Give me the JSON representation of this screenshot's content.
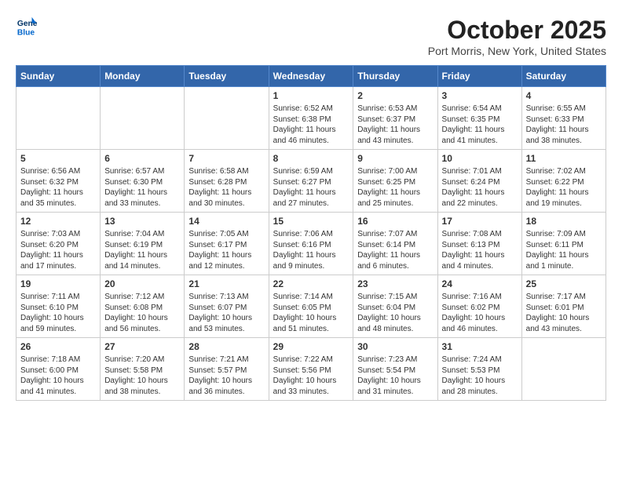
{
  "header": {
    "logo_line1": "General",
    "logo_line2": "Blue",
    "month_title": "October 2025",
    "location": "Port Morris, New York, United States"
  },
  "weekdays": [
    "Sunday",
    "Monday",
    "Tuesday",
    "Wednesday",
    "Thursday",
    "Friday",
    "Saturday"
  ],
  "weeks": [
    [
      {
        "day": "",
        "empty": true
      },
      {
        "day": "",
        "empty": true
      },
      {
        "day": "",
        "empty": true
      },
      {
        "day": "1",
        "sunrise": "6:52 AM",
        "sunset": "6:38 PM",
        "daylight": "11 hours and 46 minutes."
      },
      {
        "day": "2",
        "sunrise": "6:53 AM",
        "sunset": "6:37 PM",
        "daylight": "11 hours and 43 minutes."
      },
      {
        "day": "3",
        "sunrise": "6:54 AM",
        "sunset": "6:35 PM",
        "daylight": "11 hours and 41 minutes."
      },
      {
        "day": "4",
        "sunrise": "6:55 AM",
        "sunset": "6:33 PM",
        "daylight": "11 hours and 38 minutes."
      }
    ],
    [
      {
        "day": "5",
        "sunrise": "6:56 AM",
        "sunset": "6:32 PM",
        "daylight": "11 hours and 35 minutes."
      },
      {
        "day": "6",
        "sunrise": "6:57 AM",
        "sunset": "6:30 PM",
        "daylight": "11 hours and 33 minutes."
      },
      {
        "day": "7",
        "sunrise": "6:58 AM",
        "sunset": "6:28 PM",
        "daylight": "11 hours and 30 minutes."
      },
      {
        "day": "8",
        "sunrise": "6:59 AM",
        "sunset": "6:27 PM",
        "daylight": "11 hours and 27 minutes."
      },
      {
        "day": "9",
        "sunrise": "7:00 AM",
        "sunset": "6:25 PM",
        "daylight": "11 hours and 25 minutes."
      },
      {
        "day": "10",
        "sunrise": "7:01 AM",
        "sunset": "6:24 PM",
        "daylight": "11 hours and 22 minutes."
      },
      {
        "day": "11",
        "sunrise": "7:02 AM",
        "sunset": "6:22 PM",
        "daylight": "11 hours and 19 minutes."
      }
    ],
    [
      {
        "day": "12",
        "sunrise": "7:03 AM",
        "sunset": "6:20 PM",
        "daylight": "11 hours and 17 minutes."
      },
      {
        "day": "13",
        "sunrise": "7:04 AM",
        "sunset": "6:19 PM",
        "daylight": "11 hours and 14 minutes."
      },
      {
        "day": "14",
        "sunrise": "7:05 AM",
        "sunset": "6:17 PM",
        "daylight": "11 hours and 12 minutes."
      },
      {
        "day": "15",
        "sunrise": "7:06 AM",
        "sunset": "6:16 PM",
        "daylight": "11 hours and 9 minutes."
      },
      {
        "day": "16",
        "sunrise": "7:07 AM",
        "sunset": "6:14 PM",
        "daylight": "11 hours and 6 minutes."
      },
      {
        "day": "17",
        "sunrise": "7:08 AM",
        "sunset": "6:13 PM",
        "daylight": "11 hours and 4 minutes."
      },
      {
        "day": "18",
        "sunrise": "7:09 AM",
        "sunset": "6:11 PM",
        "daylight": "11 hours and 1 minute."
      }
    ],
    [
      {
        "day": "19",
        "sunrise": "7:11 AM",
        "sunset": "6:10 PM",
        "daylight": "10 hours and 59 minutes."
      },
      {
        "day": "20",
        "sunrise": "7:12 AM",
        "sunset": "6:08 PM",
        "daylight": "10 hours and 56 minutes."
      },
      {
        "day": "21",
        "sunrise": "7:13 AM",
        "sunset": "6:07 PM",
        "daylight": "10 hours and 53 minutes."
      },
      {
        "day": "22",
        "sunrise": "7:14 AM",
        "sunset": "6:05 PM",
        "daylight": "10 hours and 51 minutes."
      },
      {
        "day": "23",
        "sunrise": "7:15 AM",
        "sunset": "6:04 PM",
        "daylight": "10 hours and 48 minutes."
      },
      {
        "day": "24",
        "sunrise": "7:16 AM",
        "sunset": "6:02 PM",
        "daylight": "10 hours and 46 minutes."
      },
      {
        "day": "25",
        "sunrise": "7:17 AM",
        "sunset": "6:01 PM",
        "daylight": "10 hours and 43 minutes."
      }
    ],
    [
      {
        "day": "26",
        "sunrise": "7:18 AM",
        "sunset": "6:00 PM",
        "daylight": "10 hours and 41 minutes."
      },
      {
        "day": "27",
        "sunrise": "7:20 AM",
        "sunset": "5:58 PM",
        "daylight": "10 hours and 38 minutes."
      },
      {
        "day": "28",
        "sunrise": "7:21 AM",
        "sunset": "5:57 PM",
        "daylight": "10 hours and 36 minutes."
      },
      {
        "day": "29",
        "sunrise": "7:22 AM",
        "sunset": "5:56 PM",
        "daylight": "10 hours and 33 minutes."
      },
      {
        "day": "30",
        "sunrise": "7:23 AM",
        "sunset": "5:54 PM",
        "daylight": "10 hours and 31 minutes."
      },
      {
        "day": "31",
        "sunrise": "7:24 AM",
        "sunset": "5:53 PM",
        "daylight": "10 hours and 28 minutes."
      },
      {
        "day": "",
        "empty": true
      }
    ]
  ]
}
